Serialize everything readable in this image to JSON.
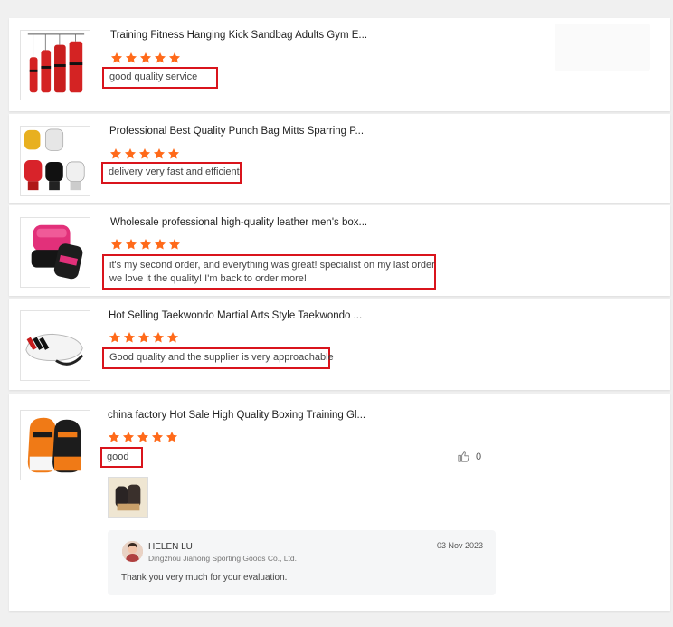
{
  "colors": {
    "star": "#ff6a1a",
    "highlight_border": "#d9141c",
    "card_bg": "#ffffff",
    "page_bg": "#f0f0f0"
  },
  "reviews": [
    {
      "title": "Training Fitness Hanging Kick Sandbag Adults Gym E...",
      "rating": 5,
      "text": "good quality service",
      "thumb_icon": "punching-bag-image"
    },
    {
      "title": "Professional Best Quality Punch Bag Mitts Sparring P...",
      "rating": 5,
      "text": "delivery very fast and efficient",
      "thumb_icon": "mma-gloves-image"
    },
    {
      "title": "Wholesale professional high-quality leather men's box...",
      "rating": 5,
      "text_lines": [
        "it's my second order, and everything was great! specialist on my last order",
        "we love it the quality! I'm back to order more!"
      ],
      "thumb_icon": "pink-mma-glove-image"
    },
    {
      "title": "Hot Selling Taekwondo Martial Arts Style Taekwondo ...",
      "rating": 5,
      "text": "Good quality and the supplier is very approachable",
      "thumb_icon": "kick-pad-image"
    },
    {
      "title": "china factory Hot Sale High Quality Boxing Training Gl...",
      "rating": 5,
      "text": "good ",
      "thumb_icon": "boxing-gloves-image",
      "like_count": "0",
      "photo_icon": "customer-photo-gloves",
      "reply": {
        "name": "HELEN LU",
        "company": "Dingzhou Jiahong Sporting Goods Co., Ltd.",
        "date": "03 Nov 2023",
        "text": "Thank you very much for your evaluation."
      }
    }
  ]
}
